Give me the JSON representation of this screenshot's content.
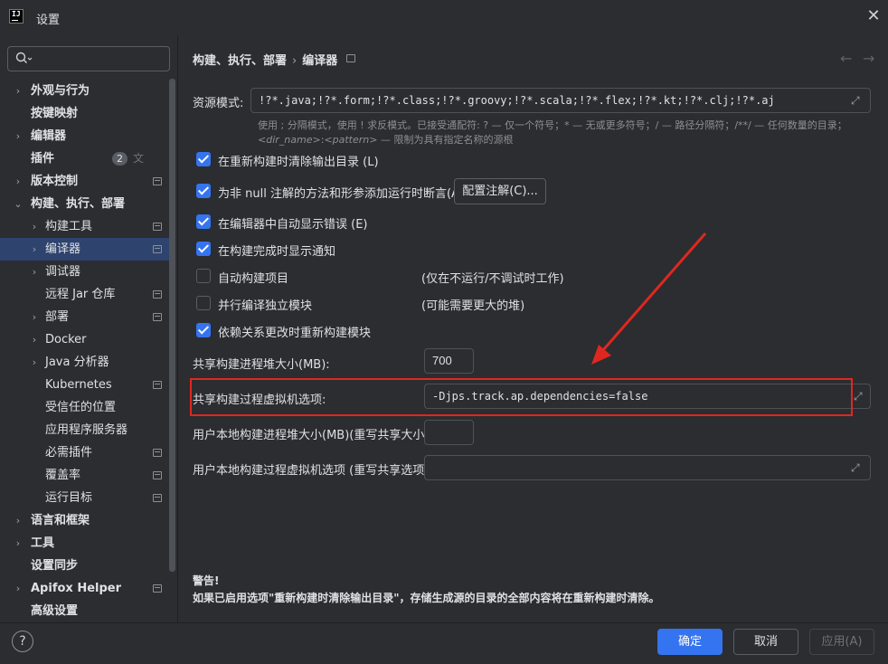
{
  "window": {
    "title": "设置"
  },
  "search": {
    "placeholder": ""
  },
  "sidebar": {
    "items": [
      {
        "label": "外观与行为",
        "chevron": "›"
      },
      {
        "label": "按键映射",
        "chevron": ""
      },
      {
        "label": "编辑器",
        "chevron": "›"
      },
      {
        "label": "插件",
        "chevron": "",
        "badge": "2"
      },
      {
        "label": "版本控制",
        "chevron": "›"
      },
      {
        "label": "构建、执行、部署",
        "chevron": "⌄"
      },
      {
        "label": "构建工具",
        "chevron": "›"
      },
      {
        "label": "编译器",
        "chevron": "›"
      },
      {
        "label": "调试器",
        "chevron": "›"
      },
      {
        "label": "远程 Jar 仓库",
        "chevron": ""
      },
      {
        "label": "部署",
        "chevron": "›"
      },
      {
        "label": "Docker",
        "chevron": "›"
      },
      {
        "label": "Java 分析器",
        "chevron": "›"
      },
      {
        "label": "Kubernetes",
        "chevron": ""
      },
      {
        "label": "受信任的位置",
        "chevron": ""
      },
      {
        "label": "应用程序服务器",
        "chevron": ""
      },
      {
        "label": "必需插件",
        "chevron": ""
      },
      {
        "label": "覆盖率",
        "chevron": ""
      },
      {
        "label": "运行目标",
        "chevron": ""
      },
      {
        "label": "语言和框架",
        "chevron": "›"
      },
      {
        "label": "工具",
        "chevron": "›"
      },
      {
        "label": "设置同步",
        "chevron": ""
      },
      {
        "label": "Apifox Helper",
        "chevron": "›"
      },
      {
        "label": "高级设置",
        "chevron": ""
      }
    ]
  },
  "breadcrumb": {
    "parent": "构建、执行、部署",
    "separator": "›",
    "current": "编译器"
  },
  "resource": {
    "label": "资源模式:",
    "value": "!?*.java;!?*.form;!?*.class;!?*.groovy;!?*.scala;!?*.flex;!?*.kt;!?*.clj;!?*.aj",
    "hint1": "使用 ; 分隔模式，使用 ! 求反模式。已接受通配符: ? — 仅一个符号；* — 无或更多符号；/ — 路径分隔符；/**/ — 任何数量的目录；",
    "hint2a": "<dir_name>",
    "hint2b": ":",
    "hint2c": "<pattern>",
    "hint2d": " — 限制为具有指定名称的源根"
  },
  "options": [
    {
      "label": "在重新构建时清除输出目录 (L)",
      "checked": true,
      "note": ""
    },
    {
      "label": "为非 null 注解的方法和形参添加运行时断言(A)",
      "checked": true,
      "note": ""
    },
    {
      "label": "在编辑器中自动显示错误 (E)",
      "checked": true,
      "note": ""
    },
    {
      "label": "在构建完成时显示通知",
      "checked": true,
      "note": ""
    },
    {
      "label": "自动构建项目",
      "checked": false,
      "note": "(仅在不运行/不调试时工作)"
    },
    {
      "label": "并行编译独立模块",
      "checked": false,
      "note": "(可能需要更大的堆)"
    },
    {
      "label": "依赖关系更改时重新构建模块",
      "checked": true,
      "note": ""
    }
  ],
  "config_annotations_button": "配置注解(C)...",
  "heap": {
    "label": "共享构建进程堆大小(MB):",
    "value": "700"
  },
  "vm_options": {
    "label": "共享构建过程虚拟机选项:",
    "value": "-Djps.track.ap.dependencies=false"
  },
  "user_heap": {
    "label": "用户本地构建进程堆大小(MB)(重写共享大小):",
    "value": ""
  },
  "user_vm": {
    "label": "用户本地构建过程虚拟机选项 (重写共享选项):",
    "value": ""
  },
  "warning": {
    "title": "警告!",
    "body": "如果已启用选项\"重新构建时清除输出目录\"，存储生成源的目录的全部内容将在重新构建时清除。"
  },
  "buttons": {
    "ok": "确定",
    "cancel": "取消",
    "apply": "应用(A)",
    "help": "?"
  },
  "colors": {
    "accent": "#3574f0",
    "highlight": "#e0271f",
    "background": "#2b2d30"
  }
}
